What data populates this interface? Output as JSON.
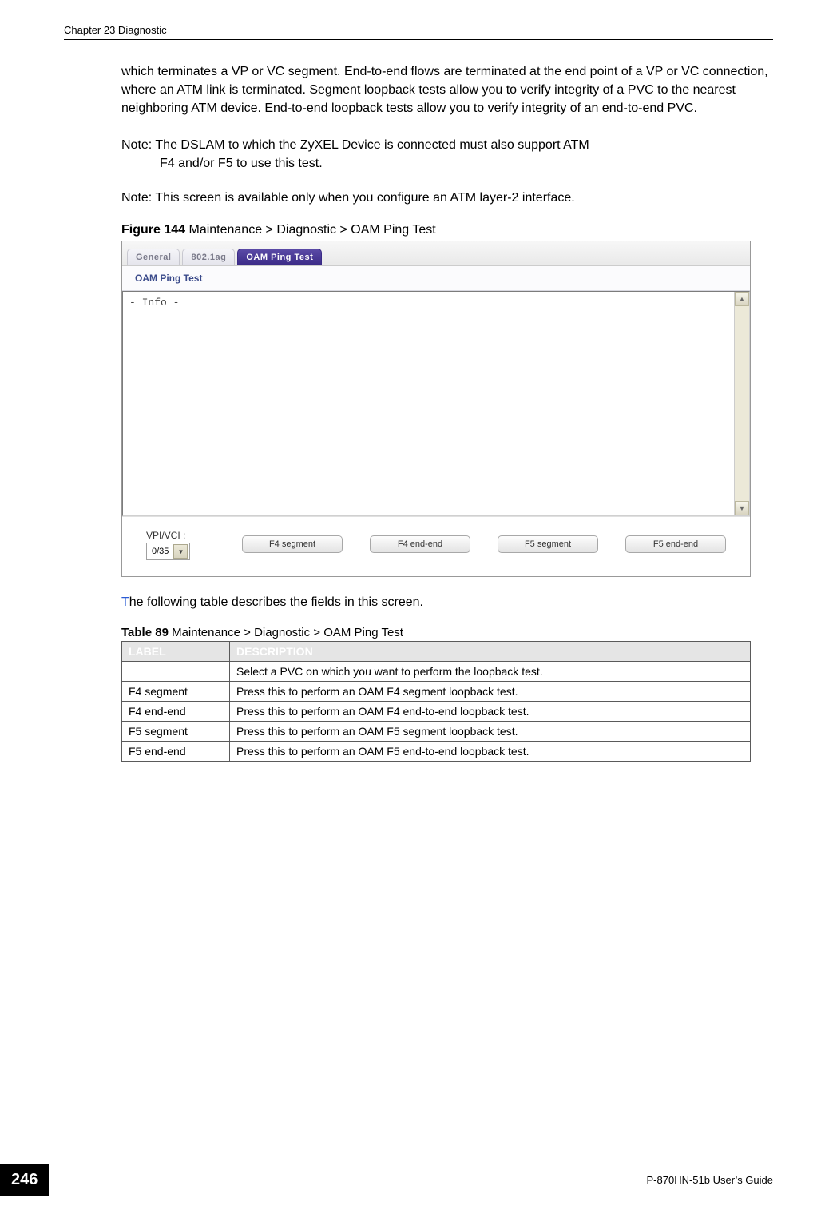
{
  "header": {
    "left": "Chapter 23 Diagnostic"
  },
  "paragraphs": {
    "intro": "which terminates a VP or VC segment. End-to-end flows are terminated at the end point of a VP or VC connection, where an ATM link is terminated. Segment loopback tests allow you to verify integrity of a PVC to the nearest neighboring ATM device. End-to-end loopback tests allow you to verify integrity of an end-to-end PVC.",
    "note1_label": "Note: ",
    "note1_text_a": "The DSLAM to which the ZyXEL Device is connected must also support ATM",
    "note1_text_b": "F4 and/or F5 to use this test.",
    "note2_label": "Note: ",
    "note2_text": "This screen is available only when you configure an ATM layer-2 interface.",
    "para_lead_letter": "T",
    "para_lead_rest": "he following table describes the fields in this screen."
  },
  "figure": {
    "label_bold": "Figure 144   ",
    "label_rest": "Maintenance > Diagnostic > OAM Ping Test"
  },
  "screenshot": {
    "tabs": {
      "general": "General",
      "t8021ag": "802.1ag",
      "oam": "OAM Ping Test"
    },
    "section_title": "OAM Ping Test",
    "textarea_value": "- Info -",
    "controls": {
      "vpivci_label": "VPI/VCI :",
      "vpivci_value": "0/35",
      "f4segment": "F4 segment",
      "f4endend": "F4 end-end",
      "f5segment": "F5 segment",
      "f5endend": "F5 end-end"
    }
  },
  "table": {
    "caption_bold": "Table 89   ",
    "caption_rest": "Maintenance > Diagnostic > OAM Ping Test",
    "head_label": "LABEL",
    "head_desc": "DESCRIPTION",
    "rows": [
      {
        "label": "",
        "desc": "Select a PVC on which you want to perform the loopback test."
      },
      {
        "label": "F4 segment",
        "desc": "Press this to perform an OAM F4 segment loopback test."
      },
      {
        "label": "F4 end-end",
        "desc": "Press this to perform an OAM F4 end-to-end loopback test."
      },
      {
        "label": "F5 segment",
        "desc": "Press this to perform an OAM F5 segment loopback test."
      },
      {
        "label": "F5 end-end",
        "desc": "Press this to perform an OAM F5 end-to-end loopback test."
      }
    ]
  },
  "footer": {
    "page": "246",
    "guide": "P-870HN-51b User’s Guide"
  }
}
